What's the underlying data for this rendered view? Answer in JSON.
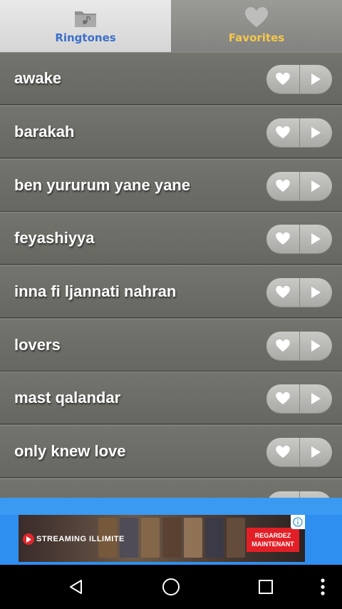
{
  "tabs": [
    {
      "label": "Ringtones",
      "icon": "folder-icon",
      "active": true
    },
    {
      "label": "Favorites",
      "icon": "heart-icon",
      "active": false
    }
  ],
  "songs": [
    "awake",
    "barakah",
    "ben yururum yane yane",
    "feyashiyya",
    "inna fi ljannati nahran",
    "lovers",
    "mast qalandar",
    "only knew love",
    ""
  ],
  "ad": {
    "brand": "STREAMING ILLIMITE",
    "cta": "REGARDEZ MAINTENANT"
  },
  "nav": {
    "back": "back-icon",
    "home": "home-icon",
    "recents": "recents-icon",
    "menu": "overflow-menu-icon"
  },
  "colors": {
    "active_tab_text": "#3b6fc9",
    "inactive_tab_text": "#f5c84a",
    "ad_bar": "#2f8ff0",
    "cta": "#e21f26"
  }
}
